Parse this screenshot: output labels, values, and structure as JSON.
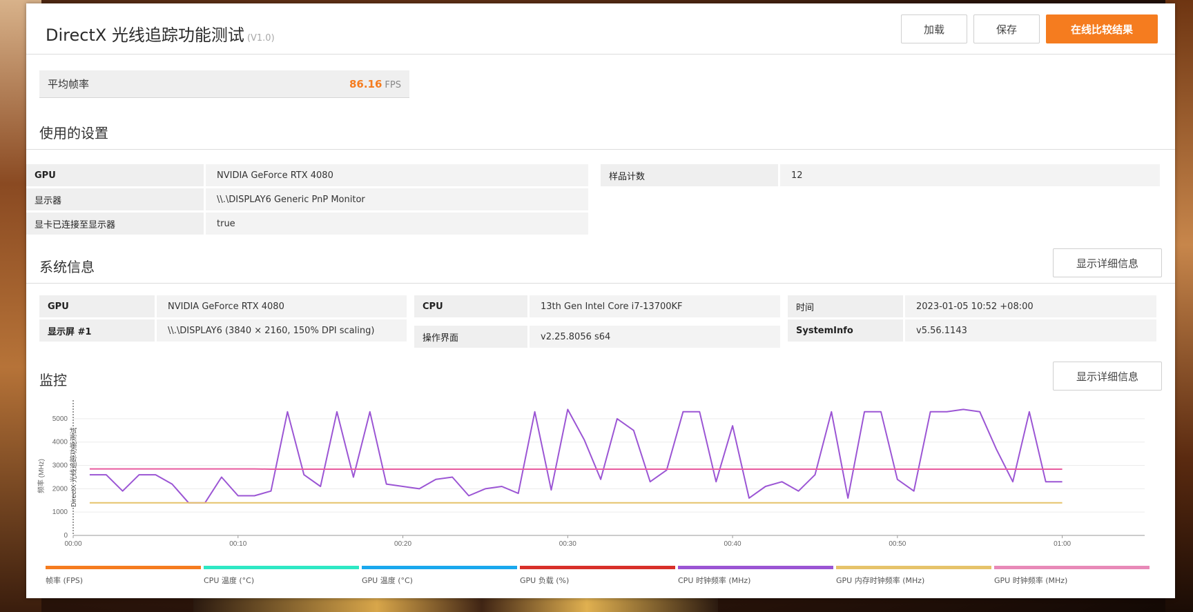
{
  "header": {
    "title": "DirectX 光线追踪功能测试",
    "version": "(V1.0)",
    "load_label": "加载",
    "save_label": "保存",
    "compare_label": "在线比较结果"
  },
  "avg_fps": {
    "label": "平均帧率",
    "value": "86.16",
    "unit": "FPS"
  },
  "settings": {
    "title": "使用的设置",
    "rows": [
      {
        "key": "GPU",
        "value": "NVIDIA GeForce RTX 4080"
      },
      {
        "key": "显示器",
        "value": "\\\\.\\DISPLAY6 Generic PnP Monitor"
      },
      {
        "key": "显卡已连接至显示器",
        "value": "true"
      }
    ],
    "right_rows": [
      {
        "key": "样品计数",
        "value": "12"
      }
    ]
  },
  "system": {
    "title": "系统信息",
    "detail_label": "显示详细信息",
    "col1": [
      {
        "key": "GPU",
        "value": "NVIDIA GeForce RTX 4080"
      },
      {
        "key": "显示屏 #1",
        "value": "\\\\.\\DISPLAY6 (3840 × 2160, 150% DPI scaling)"
      }
    ],
    "col2": [
      {
        "key": "CPU",
        "value": "13th Gen Intel Core i7-13700KF"
      },
      {
        "key": "操作界面",
        "value": "v2.25.8056 s64"
      }
    ],
    "col3": [
      {
        "key": "时间",
        "value": "2023-01-05 10:52 +08:00"
      },
      {
        "key": "SystemInfo",
        "value": "v5.56.1143"
      }
    ]
  },
  "monitor": {
    "title": "监控",
    "detail_label": "显示详细信息"
  },
  "chart_data": {
    "type": "line",
    "ylabel": "频率 (MHz)",
    "annotation": "DirectX 光线追踪功能测试",
    "ylim": [
      0,
      5500
    ],
    "yticks": [
      0,
      1000,
      2000,
      3000,
      4000,
      5000
    ],
    "xlim": [
      0,
      65
    ],
    "xticks": [
      "00:00",
      "00:10",
      "00:20",
      "00:30",
      "00:40",
      "00:50",
      "01:00"
    ],
    "x": [
      1,
      2,
      3,
      4,
      5,
      6,
      7,
      8,
      9,
      10,
      11,
      12,
      13,
      14,
      15,
      16,
      17,
      18,
      19,
      20,
      21,
      22,
      23,
      24,
      25,
      26,
      27,
      28,
      29,
      30,
      31,
      32,
      33,
      34,
      35,
      36,
      37,
      38,
      39,
      40,
      41,
      42,
      43,
      44,
      45,
      46,
      47,
      48,
      49,
      50,
      51,
      52,
      53,
      54,
      55,
      56,
      57,
      58,
      59,
      60
    ],
    "series": [
      {
        "name": "CPU 时钟频率 (MHz)",
        "color": "#9b55d4",
        "values": [
          2600,
          2600,
          1900,
          2600,
          2600,
          2200,
          1400,
          1400,
          2500,
          1700,
          1700,
          1900,
          5300,
          2600,
          2100,
          5300,
          2500,
          5300,
          2200,
          2100,
          2000,
          2400,
          2500,
          1700,
          2000,
          2100,
          1800,
          5300,
          1950,
          5400,
          4100,
          2400,
          5000,
          4500,
          2300,
          2800,
          5300,
          5300,
          2300,
          4700,
          1600,
          2100,
          2300,
          1900,
          2600,
          5300,
          1600,
          5300,
          5300,
          2400,
          1900,
          5300,
          5300,
          5400,
          5300,
          3700,
          2300,
          5300,
          2300,
          2300
        ]
      },
      {
        "name": "GPU 时钟频率 (MHz)",
        "color": "#e85a9e",
        "values": [
          2850,
          2850,
          2850,
          2850,
          2850,
          2850,
          2850,
          2850,
          2850,
          2850,
          2850,
          2840,
          2840,
          2840,
          2840,
          2840,
          2840,
          2840,
          2840,
          2840,
          2840,
          2840,
          2840,
          2840,
          2840,
          2840,
          2840,
          2840,
          2840,
          2840,
          2840,
          2840,
          2840,
          2840,
          2840,
          2840,
          2840,
          2840,
          2840,
          2840,
          2840,
          2840,
          2840,
          2840,
          2840,
          2840,
          2840,
          2840,
          2840,
          2840,
          2840,
          2840,
          2840,
          2840,
          2840,
          2840,
          2840,
          2840,
          2840,
          2840
        ]
      },
      {
        "name": "GPU 内存时钟频率 (MHz)",
        "color": "#e6c36a",
        "values": [
          1400,
          1400,
          1400,
          1400,
          1400,
          1400,
          1400,
          1400,
          1400,
          1400,
          1400,
          1400,
          1400,
          1400,
          1400,
          1400,
          1400,
          1400,
          1400,
          1400,
          1400,
          1400,
          1400,
          1400,
          1400,
          1400,
          1400,
          1400,
          1400,
          1400,
          1400,
          1400,
          1400,
          1400,
          1400,
          1400,
          1400,
          1400,
          1400,
          1400,
          1400,
          1400,
          1400,
          1400,
          1400,
          1400,
          1400,
          1400,
          1400,
          1400,
          1400,
          1400,
          1400,
          1400,
          1400,
          1400,
          1400,
          1400,
          1400,
          1400
        ]
      }
    ],
    "legend": [
      {
        "name": "帧率 (FPS)",
        "color": "#f57c1f"
      },
      {
        "name": "CPU 温度 (°C)",
        "color": "#2ee8c4"
      },
      {
        "name": "GPU 温度 (°C)",
        "color": "#1aa8ee"
      },
      {
        "name": "GPU 负载 (%)",
        "color": "#d8302a"
      },
      {
        "name": "CPU 时钟频率 (MHz)",
        "color": "#9b55d4"
      },
      {
        "name": "GPU 内存时钟频率 (MHz)",
        "color": "#e6c36a"
      },
      {
        "name": "GPU 时钟频率 (MHz)",
        "color": "#e889b8"
      }
    ]
  }
}
